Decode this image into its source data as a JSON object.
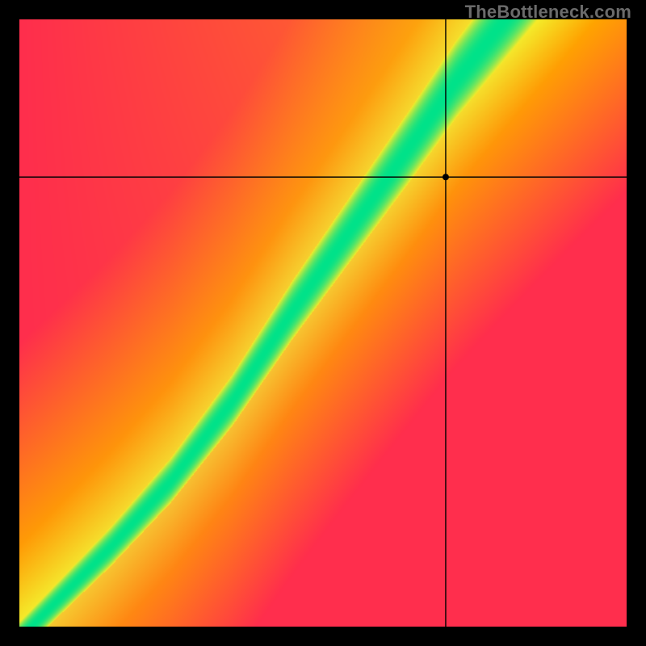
{
  "watermark": "TheBottleneck.com",
  "chart_data": {
    "type": "heatmap",
    "title": "",
    "xlabel": "",
    "ylabel": "",
    "xlim": [
      0,
      100
    ],
    "ylim": [
      0,
      100
    ],
    "crosshair": {
      "x": 70.3,
      "y": 74.0
    },
    "marker": {
      "x": 70.3,
      "y": 74.0,
      "radius": 4
    },
    "optimal_band": {
      "description": "green band of optimal pairing running from bottom-left to top-right, slightly convex toward upper-left",
      "center": [
        {
          "x": 5,
          "y": 3
        },
        {
          "x": 15,
          "y": 13
        },
        {
          "x": 25,
          "y": 24
        },
        {
          "x": 35,
          "y": 37
        },
        {
          "x": 45,
          "y": 52
        },
        {
          "x": 55,
          "y": 66
        },
        {
          "x": 65,
          "y": 80
        },
        {
          "x": 72,
          "y": 90
        },
        {
          "x": 80,
          "y": 100
        }
      ],
      "half_width_percent": 4.5
    },
    "colors": {
      "optimal": "#00e28a",
      "near": "#f5ec2a",
      "warm": "#ffa500",
      "hot": "#ff2e4d",
      "top_right": "#ffe400",
      "top_left": "#ff1744",
      "bottom_right": "#ff1744"
    }
  }
}
